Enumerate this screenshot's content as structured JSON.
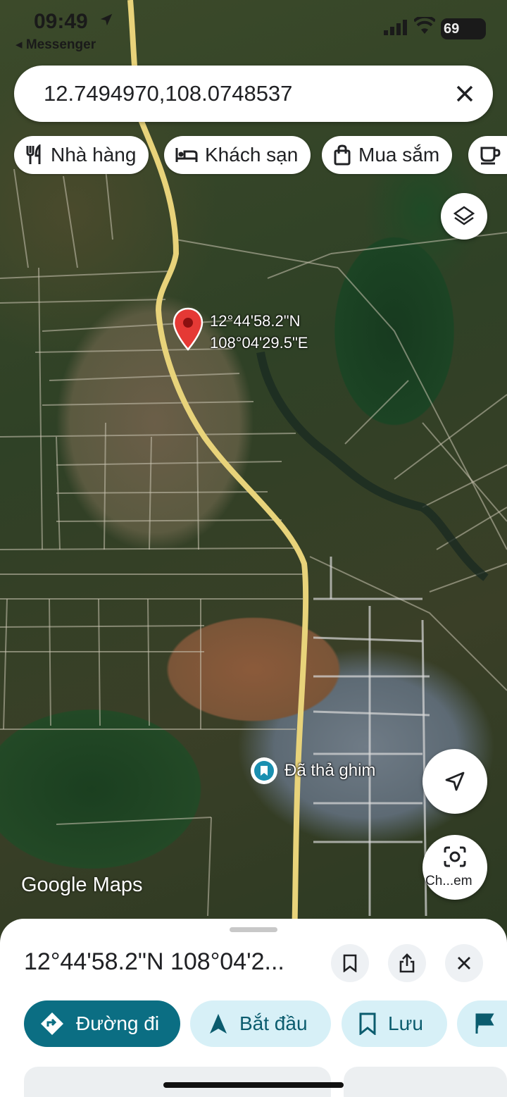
{
  "status_bar": {
    "time": "09:49",
    "back_app": "◂ Messenger",
    "battery": "69"
  },
  "search": {
    "query": "12.7494970,108.0748537"
  },
  "chips": [
    {
      "label": "Nhà hàng",
      "icon": "restaurant-icon"
    },
    {
      "label": "Khách sạn",
      "icon": "hotel-icon"
    },
    {
      "label": "Mua sắm",
      "icon": "shopping-bag-icon"
    },
    {
      "label": "",
      "icon": "coffee-icon"
    }
  ],
  "pin": {
    "lat_label": "12°44'58.2\"N",
    "lng_label": "108°04'29.5\"E"
  },
  "dropped_pin": {
    "label": "Đã thả ghim"
  },
  "map_brand": "Google Maps",
  "camera_button": {
    "label": "Ch...em"
  },
  "sheet": {
    "title": "12°44'58.2\"N 108°04'2...",
    "actions": [
      {
        "label": "Đường đi",
        "icon": "directions-icon",
        "style": "primary"
      },
      {
        "label": "Bắt đầu",
        "icon": "navigation-arrow-icon",
        "style": "secondary"
      },
      {
        "label": "Lưu",
        "icon": "bookmark-icon",
        "style": "secondary"
      },
      {
        "label": "",
        "icon": "flag-icon",
        "style": "secondary"
      }
    ]
  },
  "colors": {
    "primary": "#0b6e83",
    "secondary_bg": "#d7f0f7",
    "pin": "#e53935"
  }
}
